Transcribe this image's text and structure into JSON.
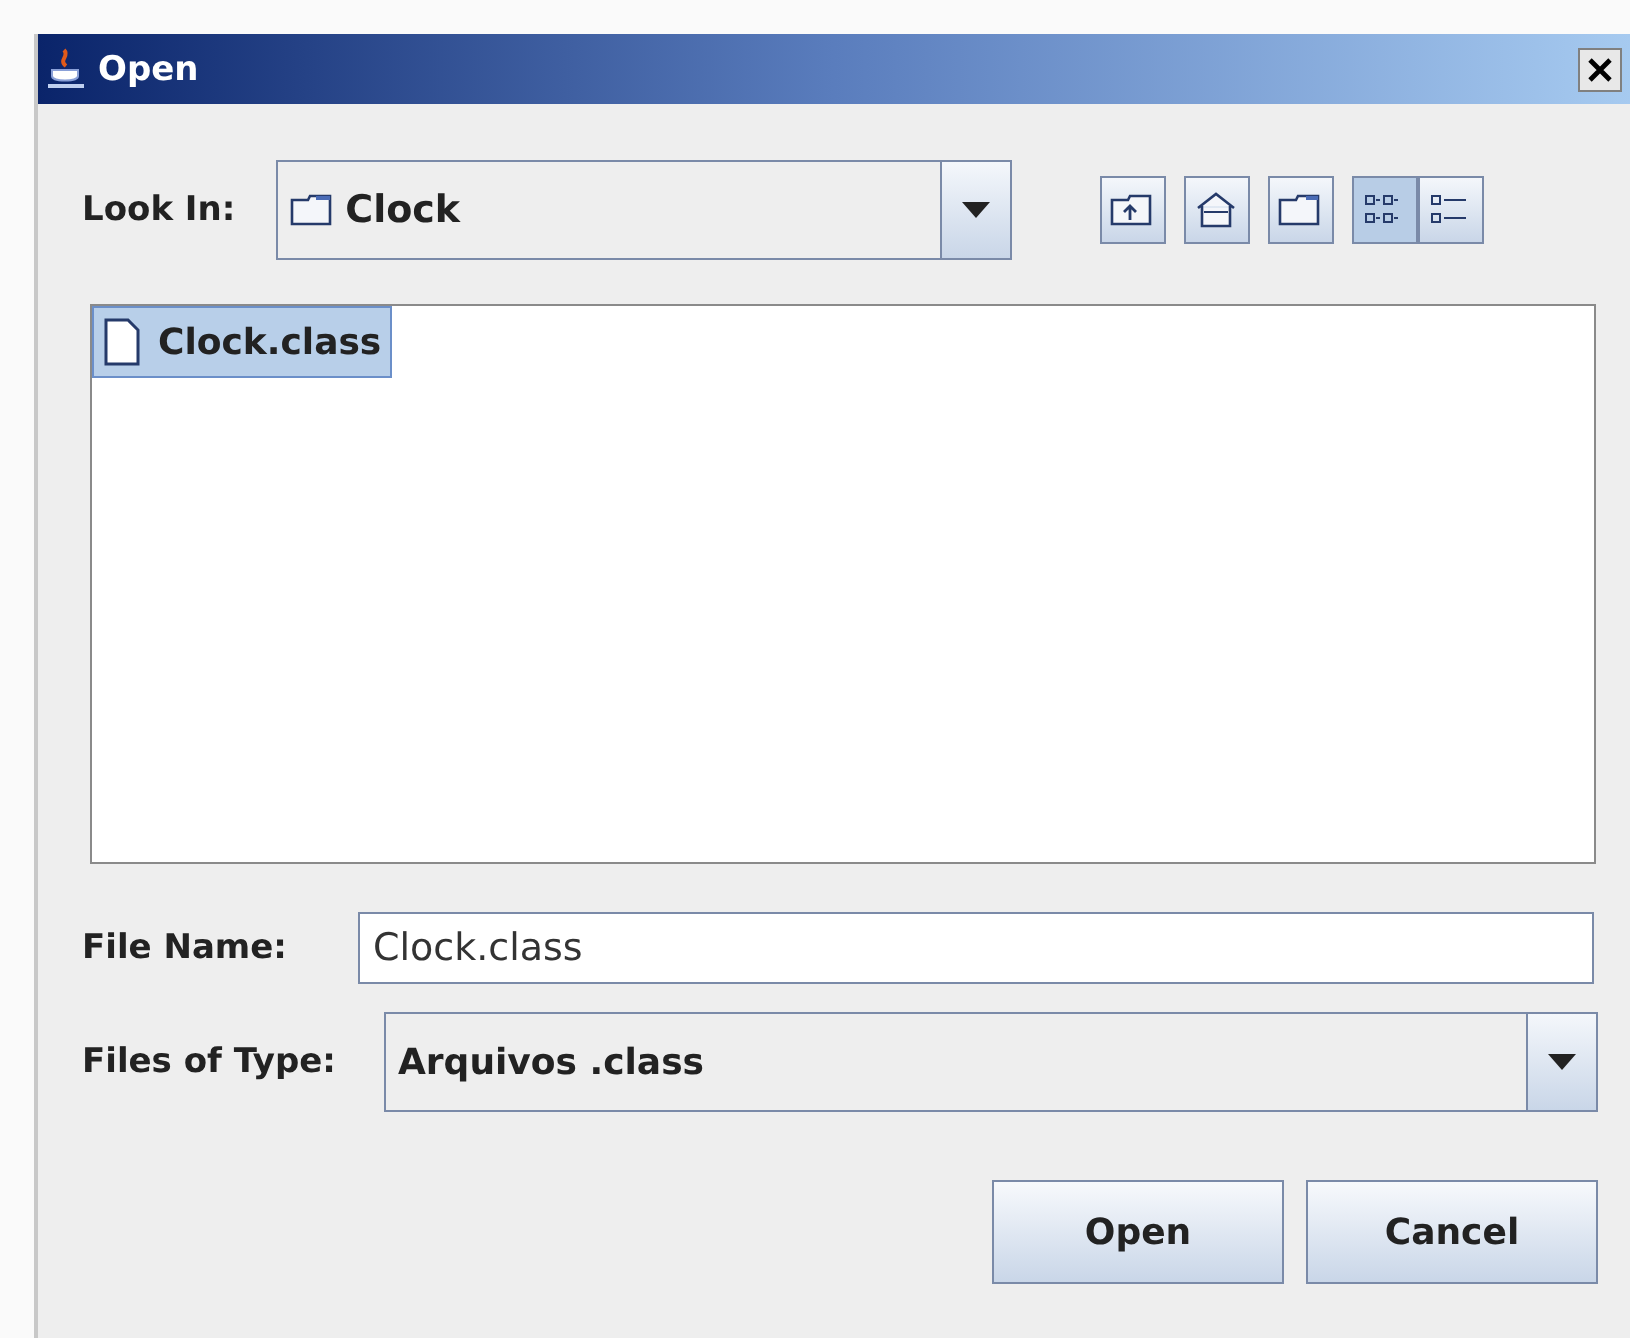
{
  "window": {
    "title": "Open"
  },
  "look_in": {
    "label": "Look In:",
    "value": "Clock"
  },
  "toolbar": [
    {
      "kind": "up",
      "selected": false
    },
    {
      "kind": "home",
      "selected": false
    },
    {
      "kind": "new-folder",
      "selected": false
    },
    {
      "kind": "list",
      "selected": true
    },
    {
      "kind": "details",
      "selected": false
    }
  ],
  "files": [
    {
      "name": "Clock.class",
      "selected": true
    }
  ],
  "file_name": {
    "label": "File Name:",
    "value": "Clock.class"
  },
  "file_type": {
    "label": "Files of Type:",
    "value": "Arquivos .class"
  },
  "buttons": [
    "Open",
    "Cancel"
  ]
}
